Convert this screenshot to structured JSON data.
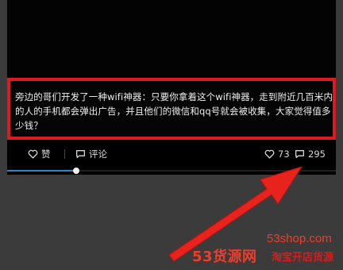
{
  "post": {
    "text": "旁边的哥们开发了一种wifi神器：只要你拿着这个wifi神器，走到附近几百米内的人的手机都会弹出广告，并且他们的微信和qq号就会被收集，大家觉得值多少钱？"
  },
  "actions": {
    "like_label": "赞",
    "comment_label": "评论",
    "like_count": "73",
    "comment_count": "295"
  },
  "player": {
    "progress": 0.21
  },
  "watermark": {
    "url": "53shop.com",
    "brand": "53货源网",
    "sub": "淘宝开店货源"
  },
  "colors": {
    "highlight_border": "#e0191f",
    "arrow": "#e8221c",
    "progress_fill": "#1f8ad8"
  },
  "icons": {
    "like": "heart-icon",
    "comment": "speech-bubble-icon"
  }
}
